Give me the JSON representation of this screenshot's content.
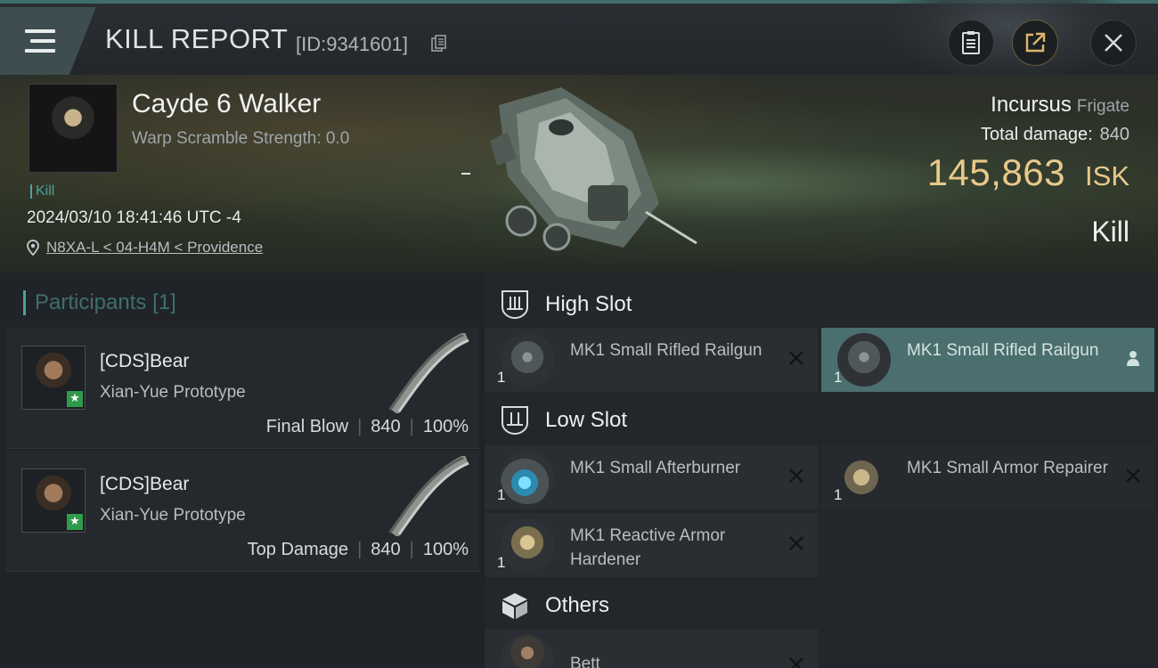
{
  "header": {
    "title": "KILL REPORT",
    "report_id": "[ID:9341601]"
  },
  "victim": {
    "pilot_name": "Cayde 6 Walker",
    "warp_scramble": "Warp Scramble Strength: 0.0",
    "kill_tag": "Kill",
    "timestamp": "2024/03/10 18:41:46 UTC -4",
    "location": "N8XA-L < 04-H4M < Providence",
    "ship_name": "Incursus",
    "ship_class": "Frigate",
    "total_damage_label": "Total damage:",
    "total_damage_value": "840",
    "isk_value": "145,863",
    "isk_unit": "ISK",
    "result": "Kill"
  },
  "participants": {
    "title": "Participants",
    "count": "[1]",
    "items": [
      {
        "name": "[CDS]Bear",
        "ship": "Xian-Yue Prototype",
        "role": "Final Blow",
        "damage": "840",
        "percent": "100%"
      },
      {
        "name": "[CDS]Bear",
        "ship": "Xian-Yue Prototype",
        "role": "Top Damage",
        "damage": "840",
        "percent": "100%"
      }
    ]
  },
  "fittings": {
    "high_slot": {
      "label": "High Slot",
      "items": [
        {
          "name": "MK1 Small Rifled Railgun",
          "qty": "1"
        },
        {
          "name": "MK1 Small Rifled Railgun",
          "qty": "1"
        }
      ]
    },
    "low_slot": {
      "label": "Low Slot",
      "items": [
        {
          "name": "MK1 Small Afterburner",
          "qty": "1"
        },
        {
          "name": "MK1 Small Armor Repairer",
          "qty": "1"
        },
        {
          "name": "MK1 Reactive Armor Hardener",
          "qty": "1"
        }
      ]
    },
    "others": {
      "label": "Others",
      "items": [
        {
          "name": "Bett"
        }
      ]
    }
  },
  "colors": {
    "accent_teal": "#4aa29a",
    "isk_gold": "#e8c98a",
    "highlight_row": "#4a6f6e"
  },
  "icons": [
    "menu-icon",
    "copy-id-icon",
    "clipboard-icon",
    "share-icon",
    "close-icon",
    "location-pin-icon",
    "high-slot-icon",
    "low-slot-icon",
    "others-cube-icon",
    "remove-x-icon",
    "pilot-icon",
    "star-badge-icon"
  ]
}
